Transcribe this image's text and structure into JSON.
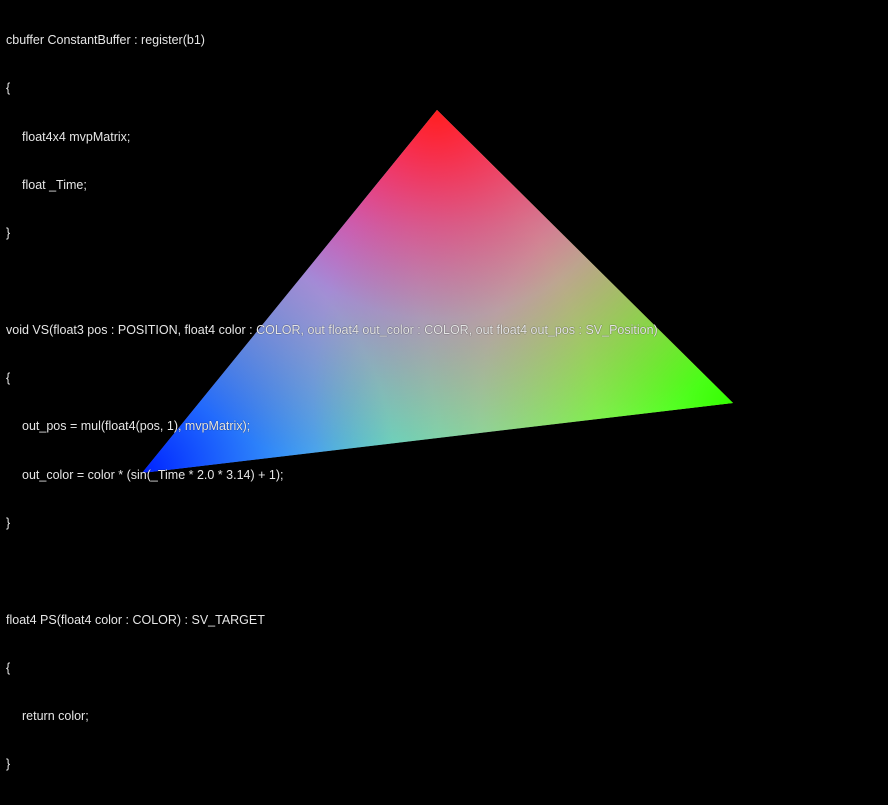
{
  "window": {
    "background": "#000000"
  },
  "triangle": {
    "vertex_colors": {
      "top": "#ff2a2a",
      "right": "#33ff00",
      "left": "#0022ff"
    }
  },
  "shader_code": {
    "text_color": "#e6e6e6",
    "lines": [
      "cbuffer ConstantBuffer : register(b1)",
      "{",
      "float4x4 mvpMatrix;",
      "float _Time;",
      "}",
      "",
      "void VS(float3 pos : POSITION, float4 color : COLOR, out float4 out_color : COLOR, out float4 out_pos : SV_Position)",
      "{",
      "out_pos = mul(float4(pos, 1), mvpMatrix);",
      "out_color = color * (sin(_Time * 2.0 * 3.14) + 1);",
      "}",
      "",
      "float4 PS(float4 color : COLOR) : SV_TARGET",
      "{",
      "return color;",
      "}"
    ]
  }
}
